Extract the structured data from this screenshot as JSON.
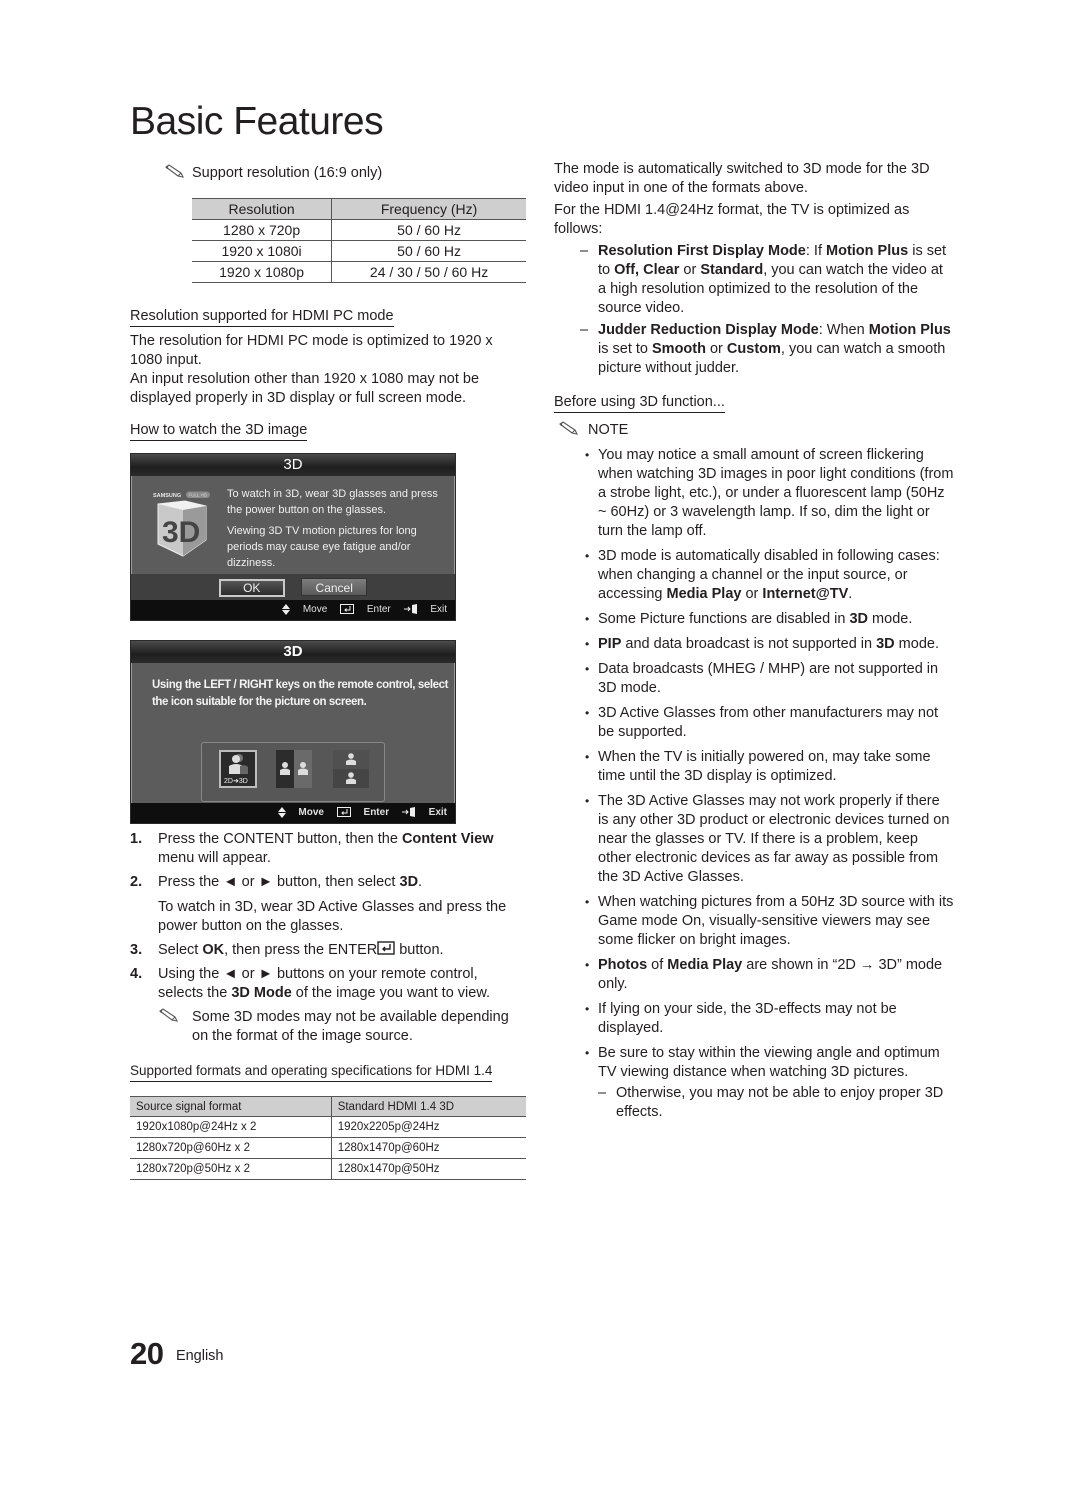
{
  "page": {
    "title": "Basic Features",
    "page_number": "20",
    "language": "English"
  },
  "left": {
    "support_note": "Support resolution (16:9 only)",
    "resolution_table": {
      "headers": [
        "Resolution",
        "Frequency (Hz)"
      ],
      "rows": [
        [
          "1280 x 720p",
          "50 / 60 Hz"
        ],
        [
          "1920 x 1080i",
          "50 / 60 Hz"
        ],
        [
          "1920 x 1080p",
          "24 / 30 / 50 / 60 Hz"
        ]
      ]
    },
    "hdmi_pc_heading": "Resolution supported for HDMI PC mode",
    "hdmi_pc_text1": "The resolution for HDMI PC mode is optimized to 1920 x 1080 input.",
    "hdmi_pc_text2": "An input resolution other than 1920 x 1080 may not be displayed properly in 3D display or full screen mode.",
    "how_to_heading": "How to watch the 3D image",
    "dialog1": {
      "title": "3D",
      "logo_brand": "SAMSUNG",
      "logo_badge": "FULL HD",
      "logo_text": "3D",
      "message1": "To watch in 3D, wear 3D glasses and press the power button on the glasses.",
      "message2": "Viewing 3D TV motion pictures for long periods may cause eye fatigue and/or dizziness.",
      "ok_label": "OK",
      "cancel_label": "Cancel",
      "footer": {
        "move": "Move",
        "enter": "Enter",
        "exit": "Exit"
      }
    },
    "dialog2": {
      "title": "3D",
      "message": "Using the LEFT / RIGHT keys on the remote control, select the icon suitable for the picture on screen.",
      "modes": [
        {
          "icon": "person-2d-to-3d-icon",
          "label": "2D➜3D",
          "selected": true
        },
        {
          "icon": "side-by-side-icon",
          "label": "",
          "selected": false
        },
        {
          "icon": "top-bottom-icon",
          "label": "",
          "selected": false
        }
      ],
      "footer": {
        "move": "Move",
        "enter": "Enter",
        "exit": "Exit"
      }
    },
    "steps": [
      {
        "num": "1.",
        "parts": [
          "Press the CONTENT button, then the ",
          "Content View",
          " menu will appear."
        ]
      },
      {
        "num": "2.",
        "parts": [
          "Press the ◄ or ► button, then select ",
          "3D",
          "."
        ],
        "sub": "To watch in 3D, wear 3D Active Glasses and press the power button on the glasses."
      },
      {
        "num": "3.",
        "parts": [
          "Select ",
          "OK",
          ", then press the ENTER",
          "",
          " button."
        ]
      },
      {
        "num": "4.",
        "parts": [
          "Using the ◄ or ► buttons on your remote control, selects the ",
          "3D Mode",
          " of the image you want to view."
        ],
        "note": "Some 3D modes may not be available depending on the format of the image source."
      }
    ],
    "hdmi14_heading": "Supported formats and operating specifications for HDMI 1.4",
    "hdmi14_table": {
      "headers": [
        "Source signal format",
        "Standard HDMI 1.4 3D"
      ],
      "rows": [
        [
          "1920x1080p@24Hz x 2",
          "1920x2205p@24Hz"
        ],
        [
          "1280x720p@60Hz x 2",
          "1280x1470p@60Hz"
        ],
        [
          "1280x720p@50Hz x 2",
          "1280x1470p@50Hz"
        ]
      ]
    }
  },
  "right": {
    "intro1": "The mode is automatically switched to 3D mode for the 3D video input in one of the formats above.",
    "intro2": "For the HDMI 1.4@24Hz format, the TV is optimized as follows:",
    "modes": [
      {
        "parts": [
          "Resolution First Display Mode",
          ": If ",
          "Motion Plus",
          " is set to ",
          "Off, Clear",
          " or ",
          "Standard",
          ", you can watch the video at a high resolution optimized to the resolution of the source video."
        ]
      },
      {
        "parts": [
          "Judder Reduction Display Mode",
          ": When ",
          "Motion Plus",
          " is set to ",
          "Smooth",
          " or ",
          "Custom",
          ", you can watch a smooth picture without judder."
        ]
      }
    ],
    "before_heading": "Before using 3D function...",
    "note_label": "NOTE",
    "bullets": [
      [
        "You may notice a small amount of screen flickering when watching 3D images in poor light conditions (from a strobe light, etc.), or under a fluorescent lamp (50Hz ~ 60Hz) or 3 wavelength lamp. If so, dim the light or turn the lamp off."
      ],
      [
        "3D mode is automatically disabled in following cases: when changing a channel or the input source, or accessing ",
        "Media Play",
        " or ",
        "Internet@TV",
        "."
      ],
      [
        "Some Picture functions are disabled in ",
        "3D",
        " mode."
      ],
      [
        "",
        "PIP",
        " and data broadcast is not supported in ",
        "3D",
        " mode."
      ],
      [
        "Data broadcasts (MHEG / MHP) are not supported in 3D mode."
      ],
      [
        "3D Active Glasses from other manufacturers may not be supported."
      ],
      [
        "When the TV is initially powered on, may take some time until the 3D display is optimized."
      ],
      [
        "The 3D Active Glasses may not work properly if there is any other 3D product or electronic devices turned on near the glasses or TV. If there is a problem, keep other electronic devices as far away as possible from the 3D Active Glasses."
      ],
      [
        "When watching pictures from a 50Hz 3D source with its Game mode On, visually-sensitive viewers may see some flicker on bright images."
      ],
      [
        "",
        "Photos",
        " of ",
        "Media Play",
        " are shown in “2D → 3D” mode only."
      ],
      [
        "If lying on your side, the 3D-effects may not be displayed."
      ],
      [
        "Be sure to stay within the viewing angle and optimum TV viewing distance when watching 3D pictures."
      ]
    ],
    "last_subdash": "Otherwise, you may not be able to enjoy proper 3D effects."
  }
}
